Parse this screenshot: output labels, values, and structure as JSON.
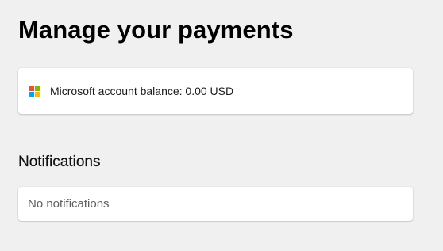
{
  "page": {
    "title": "Manage your payments"
  },
  "balance": {
    "logo_icon": "microsoft-logo-icon",
    "logo_colors": [
      "#f25022",
      "#7fba00",
      "#00a4ef",
      "#ffb900"
    ],
    "text": "Microsoft account balance: 0.00 USD"
  },
  "notifications": {
    "heading": "Notifications",
    "empty_text": "No notifications"
  }
}
